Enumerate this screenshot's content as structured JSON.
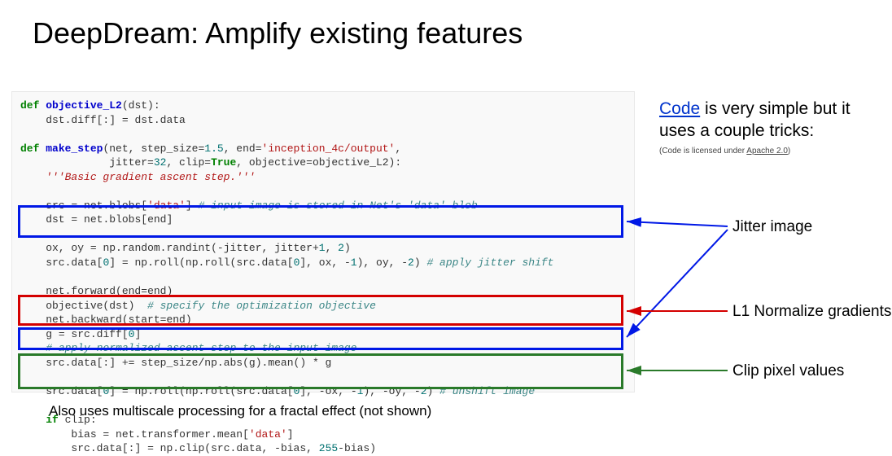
{
  "title": "DeepDream: Amplify existing features",
  "rhs": {
    "link_text": "Code",
    "line1_rest": " is very simple but it uses a couple tricks:",
    "license_prefix": "(Code is licensed under ",
    "license_link": "Apache 2.0",
    "license_suffix": ")"
  },
  "labels": {
    "jitter": "Jitter image",
    "l1": "L1 Normalize gradients",
    "clip": "Clip pixel values"
  },
  "footer": "Also uses multiscale processing for a fractal effect (not shown)",
  "code": {
    "l00_def": "def ",
    "l00_fn": "objective_L2",
    "l00_rest": "(dst):",
    "l01": "    dst.diff[:] ",
    "l01_op": "=",
    "l01_rest": " dst.data",
    "l02": "",
    "l03_def": "def ",
    "l03_fn": "make_step",
    "l03_rest1": "(net, step_size",
    "l03_eq1": "=",
    "l03_num1": "1.5",
    "l03_rest2": ", end",
    "l03_eq2": "=",
    "l03_str1": "'inception_4c/output'",
    "l03_rest3": ",",
    "l04_pad": "              jitter",
    "l04_eq1": "=",
    "l04_num1": "32",
    "l04_rest1": ", clip",
    "l04_eq2": "=",
    "l04_true": "True",
    "l04_rest2": ", objective",
    "l04_eq3": "=",
    "l04_rest3": "objective_L2):",
    "l05_doc": "    '''Basic gradient ascent step.'''",
    "l06": "",
    "l07a": "    src ",
    "l07op": "=",
    "l07b": " net",
    "l07dot": ".",
    "l07c": "blobs[",
    "l07str": "'data'",
    "l07d": "] ",
    "l07com": "# input image is stored in Net's 'data' blob",
    "l08a": "    dst ",
    "l08op": "=",
    "l08b": " net",
    "l08dot": ".",
    "l08c": "blobs[end]",
    "l09": "",
    "l10a": "    ox, oy ",
    "l10op": "=",
    "l10b": " np",
    "l10dot1": ".",
    "l10c": "random",
    "l10dot2": ".",
    "l10d": "randint(",
    "l10neg": "-",
    "l10e": "jitter, jitter",
    "l10plus": "+",
    "l10n1": "1",
    "l10f": ", ",
    "l10n2": "2",
    "l10g": ")",
    "l11a": "    src",
    "l11dot1": ".",
    "l11b": "data[",
    "l11n0": "0",
    "l11c": "] ",
    "l11op": "=",
    "l11d": " np",
    "l11dot2": ".",
    "l11e": "roll(np",
    "l11dot3": ".",
    "l11f": "roll(src",
    "l11dot4": ".",
    "l11g": "data[",
    "l11n0b": "0",
    "l11h": "], ox, ",
    "l11neg1": "-",
    "l11n1": "1",
    "l11i": "), oy, ",
    "l11neg2": "-",
    "l11n2": "2",
    "l11j": ") ",
    "l11com": "# apply jitter shift",
    "l12": "",
    "l13a": "    net",
    "l13dot": ".",
    "l13b": "forward(end",
    "l13op": "=",
    "l13c": "end)",
    "l14a": "    objective(dst)  ",
    "l14com": "# specify the optimization objective",
    "l15a": "    net",
    "l15dot": ".",
    "l15b": "backward(start",
    "l15op": "=",
    "l15c": "end)",
    "l16a": "    g ",
    "l16op": "=",
    "l16b": " src",
    "l16dot": ".",
    "l16c": "diff[",
    "l16n0": "0",
    "l16d": "]",
    "l17com": "    # apply normalized ascent step to the input image",
    "l18a": "    src",
    "l18dot": ".",
    "l18b": "data[:] ",
    "l18op": "+=",
    "l18c": " step_size",
    "l18div": "/",
    "l18d": "np",
    "l18dot2": ".",
    "l18e": "abs(g)",
    "l18dot3": ".",
    "l18f": "mean() ",
    "l18mul": "*",
    "l18g": " g",
    "l19": "",
    "l20a": "    src",
    "l20dot": ".",
    "l20b": "data[",
    "l20n0": "0",
    "l20c": "] ",
    "l20op": "=",
    "l20d": " np",
    "l20dot2": ".",
    "l20e": "roll(np",
    "l20dot3": ".",
    "l20f": "roll(src",
    "l20dot4": ".",
    "l20g": "data[",
    "l20n0b": "0",
    "l20h": "], ",
    "l20neg1": "-",
    "l20i": "ox, ",
    "l20neg2": "-",
    "l20n1": "1",
    "l20j": "), ",
    "l20neg3": "-",
    "l20k": "oy, ",
    "l20neg4": "-",
    "l20n2": "2",
    "l20l": ") ",
    "l20com": "# unshift image",
    "l21": "",
    "l22a": "    if",
    "l22b": " clip:",
    "l23a": "        bias ",
    "l23op": "=",
    "l23b": " net",
    "l23dot": ".",
    "l23c": "transformer",
    "l23dot2": ".",
    "l23d": "mean[",
    "l23str": "'data'",
    "l23e": "]",
    "l24a": "        src",
    "l24dot": ".",
    "l24b": "data[:] ",
    "l24op": "=",
    "l24c": " np",
    "l24dot2": ".",
    "l24d": "clip(src",
    "l24dot3": ".",
    "l24e": "data, ",
    "l24neg": "-",
    "l24f": "bias, ",
    "l24n255": "255",
    "l24minus": "-",
    "l24g": "bias)"
  }
}
